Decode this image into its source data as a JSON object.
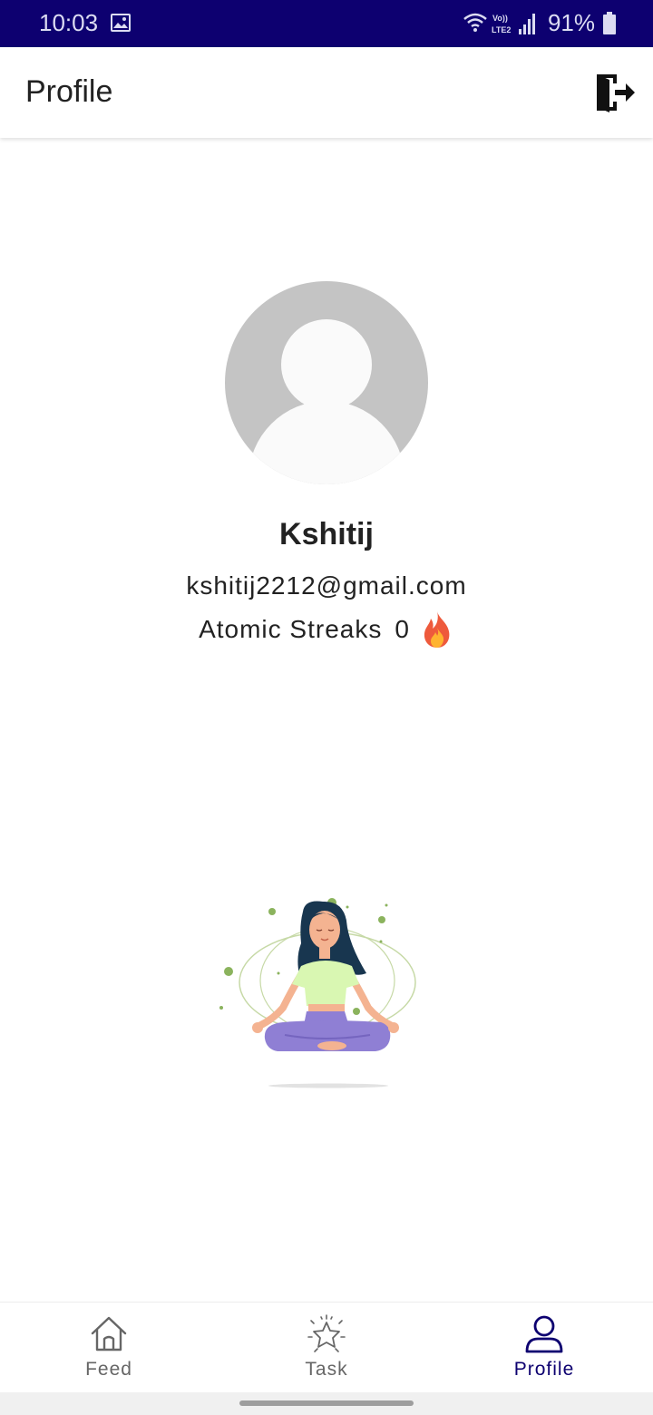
{
  "status_bar": {
    "time": "10:03",
    "network_label": "Vo)) LTE2",
    "battery_percent": "91%",
    "icons": [
      "gallery-icon",
      "wifi-icon",
      "signal-icon",
      "battery-icon"
    ]
  },
  "app_bar": {
    "title": "Profile",
    "logout_icon": "logout-icon"
  },
  "profile": {
    "name": "Kshitij",
    "email": "kshitij2212@gmail.com",
    "streak_label": "Atomic Streaks",
    "streak_count": "0",
    "streak_icon": "fire-icon",
    "avatar_icon": "avatar-placeholder-icon",
    "illustration": "meditation-illustration"
  },
  "bottom_nav": {
    "items": [
      {
        "label": "Feed",
        "icon": "home-icon",
        "active": false
      },
      {
        "label": "Task",
        "icon": "star-icon",
        "active": false
      },
      {
        "label": "Profile",
        "icon": "user-icon",
        "active": true
      }
    ]
  },
  "colors": {
    "status_bar_bg": "#0d0070",
    "accent": "#0d0070",
    "inactive_nav": "#666666",
    "avatar_bg": "#c4c4c4"
  }
}
